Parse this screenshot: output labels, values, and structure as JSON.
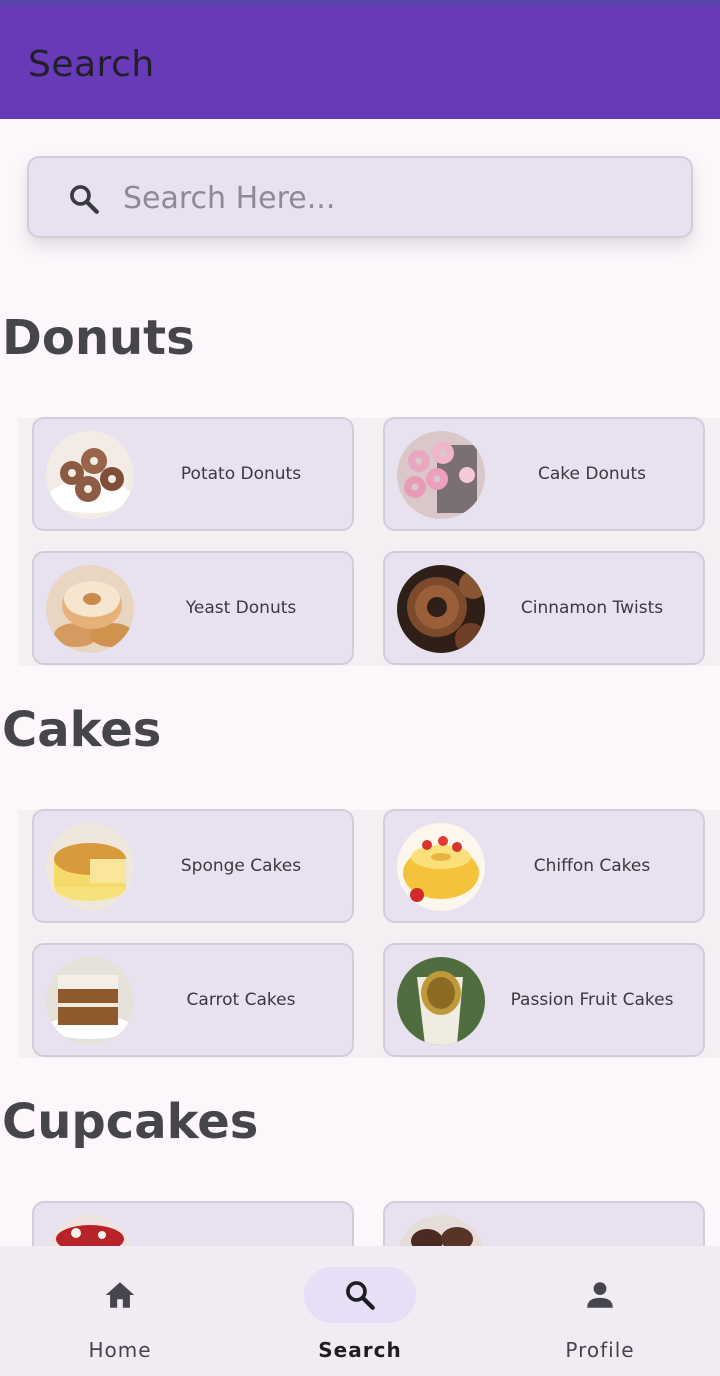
{
  "appbar": {
    "title": "Search"
  },
  "search": {
    "placeholder": "Search Here..."
  },
  "sections": [
    {
      "title": "Donuts",
      "items": [
        "Potato Donuts",
        "Cake Donuts",
        "Yeast Donuts",
        "Cinnamon Twists"
      ]
    },
    {
      "title": "Cakes",
      "items": [
        "Sponge Cakes",
        "Chiffon Cakes",
        "Carrot Cakes",
        "Passion Fruit Cakes"
      ]
    },
    {
      "title": "Cupcakes",
      "items": [
        "",
        ""
      ]
    }
  ],
  "nav": {
    "items": [
      "Home",
      "Search",
      "Profile"
    ],
    "active": "Search"
  },
  "colors": {
    "appbar": "#673ab7",
    "card": "#e8e2f0",
    "nav_active_pill": "#e6dff6"
  }
}
